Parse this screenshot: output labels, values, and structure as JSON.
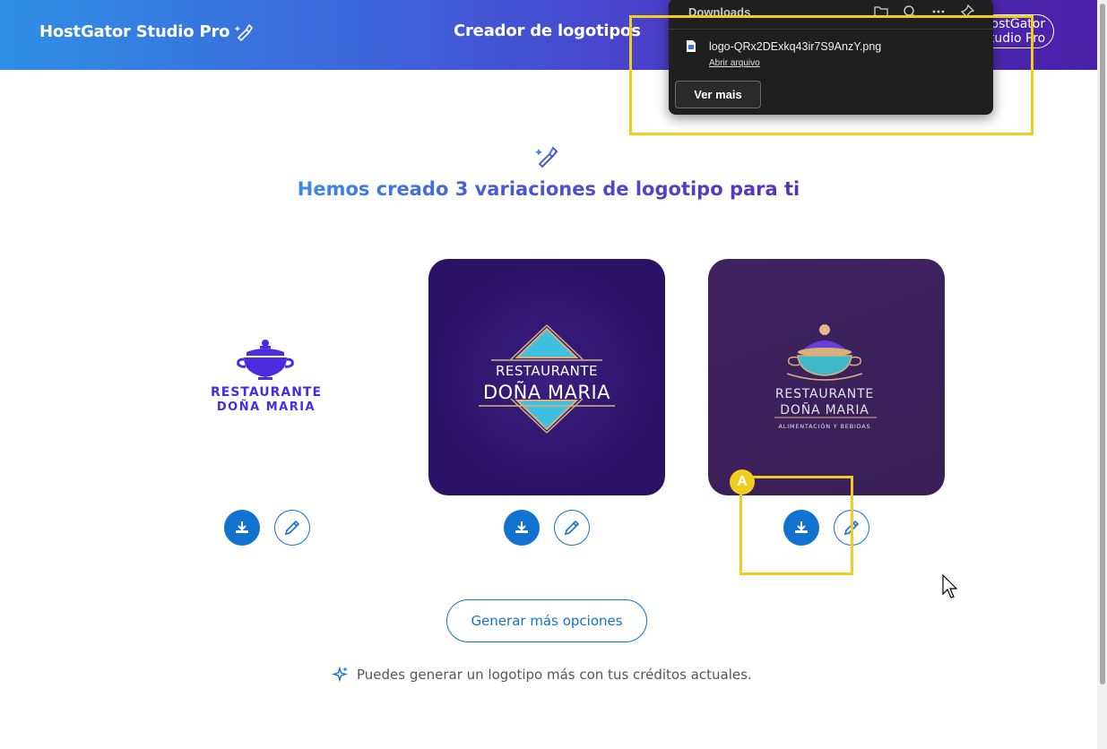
{
  "header": {
    "brand": "HostGator Studio Pro",
    "title": "Creador de logotipos",
    "button_label": "HostGator Studio Pro"
  },
  "hero": {
    "title_part1": "Hemos creado 3 variaciones de logotipo para ti"
  },
  "logos": [
    {
      "line1": "RESTAURANTE",
      "line2": "DOÑA MARIA",
      "icon": "pot-icon"
    },
    {
      "line1": "RESTAURANTE",
      "line2": "DOÑA MARIA",
      "icon": "diamond-emblem"
    },
    {
      "line1": "RESTAURANTE",
      "line2": "DOÑA MARIA",
      "tagline": "ALIMENTACIÓN Y BEBIDAS",
      "icon": "tureen-icon"
    }
  ],
  "actions": {
    "download_icon": "download-icon",
    "edit_icon": "pencil-icon"
  },
  "generate_button": "Generar más opciones",
  "credits_text": "Puedes generar un logotipo más con tus créditos actuales.",
  "downloads_panel": {
    "title": "Downloads",
    "file_name": "logo-QRx2DExkq43ir7S9AnzY.png",
    "open_link": "Abrir arquivo",
    "more_button": "Ver mais"
  },
  "annotation": {
    "badge": "A",
    "color": "#f2cc1f"
  },
  "colors": {
    "primary_blue": "#1272d0",
    "header_start": "#2f8fe6",
    "header_end": "#4b1fa8",
    "logo_purple": "#4a2be0"
  }
}
